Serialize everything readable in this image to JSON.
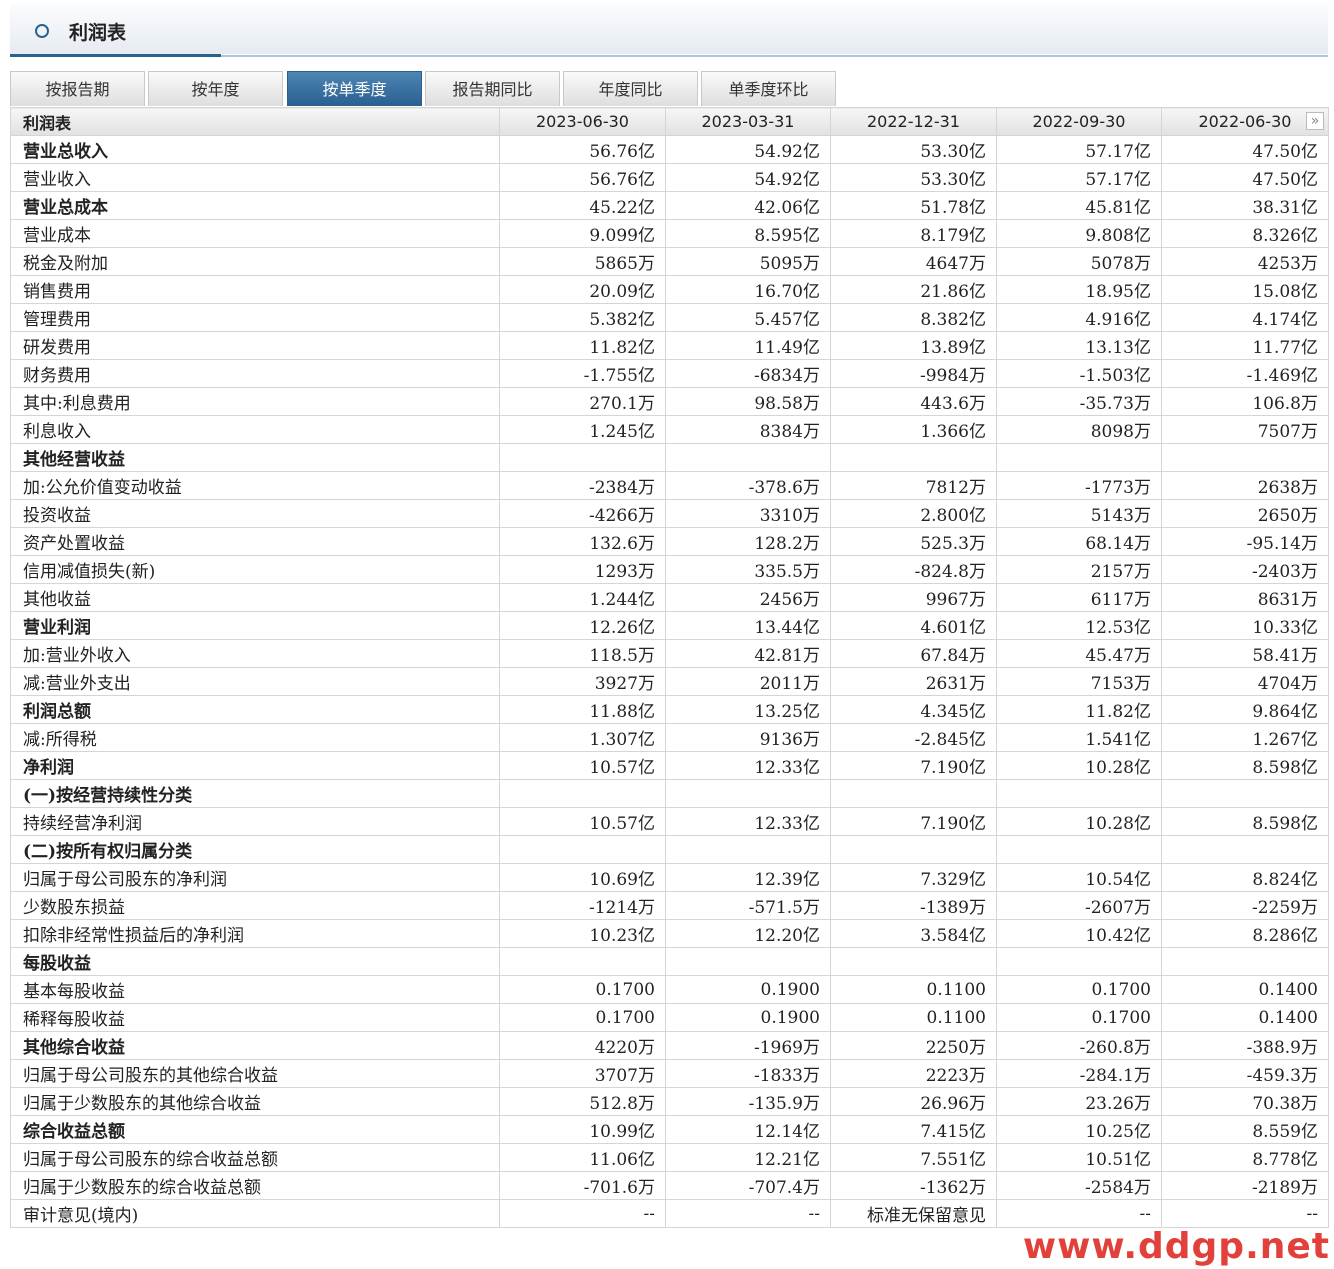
{
  "header": {
    "title": "利润表"
  },
  "tabs": [
    {
      "label": "按报告期",
      "active": false
    },
    {
      "label": "按年度",
      "active": false
    },
    {
      "label": "按单季度",
      "active": true
    },
    {
      "label": "报告期同比",
      "active": false
    },
    {
      "label": "年度同比",
      "active": false
    },
    {
      "label": "单季度环比",
      "active": false
    }
  ],
  "table": {
    "corner_label": "利润表",
    "periods": [
      "2023-06-30",
      "2023-03-31",
      "2022-12-31",
      "2022-09-30",
      "2022-06-30"
    ],
    "rows": [
      {
        "label": "营业总收入",
        "level": 0,
        "values": [
          "56.76亿",
          "54.92亿",
          "53.30亿",
          "57.17亿",
          "47.50亿"
        ]
      },
      {
        "label": "营业收入",
        "level": 1,
        "values": [
          "56.76亿",
          "54.92亿",
          "53.30亿",
          "57.17亿",
          "47.50亿"
        ]
      },
      {
        "label": "营业总成本",
        "level": 0,
        "values": [
          "45.22亿",
          "42.06亿",
          "51.78亿",
          "45.81亿",
          "38.31亿"
        ]
      },
      {
        "label": "营业成本",
        "level": 1,
        "values": [
          "9.099亿",
          "8.595亿",
          "8.179亿",
          "9.808亿",
          "8.326亿"
        ]
      },
      {
        "label": "税金及附加",
        "level": 1,
        "values": [
          "5865万",
          "5095万",
          "4647万",
          "5078万",
          "4253万"
        ]
      },
      {
        "label": "销售费用",
        "level": 1,
        "values": [
          "20.09亿",
          "16.70亿",
          "21.86亿",
          "18.95亿",
          "15.08亿"
        ]
      },
      {
        "label": "管理费用",
        "level": 1,
        "values": [
          "5.382亿",
          "5.457亿",
          "8.382亿",
          "4.916亿",
          "4.174亿"
        ]
      },
      {
        "label": "研发费用",
        "level": 1,
        "values": [
          "11.82亿",
          "11.49亿",
          "13.89亿",
          "13.13亿",
          "11.77亿"
        ]
      },
      {
        "label": "财务费用",
        "level": 1,
        "values": [
          "-1.755亿",
          "-6834万",
          "-9984万",
          "-1.503亿",
          "-1.469亿"
        ]
      },
      {
        "label": "其中:利息费用",
        "level": 1,
        "values": [
          "270.1万",
          "98.58万",
          "443.6万",
          "-35.73万",
          "106.8万"
        ]
      },
      {
        "label": "利息收入",
        "level": 3,
        "values": [
          "1.245亿",
          "8384万",
          "1.366亿",
          "8098万",
          "7507万"
        ]
      },
      {
        "label": "其他经营收益",
        "level": 0,
        "values": [
          "",
          "",
          "",
          "",
          ""
        ]
      },
      {
        "label": "加:公允价值变动收益",
        "level": 1,
        "values": [
          "-2384万",
          "-378.6万",
          "7812万",
          "-1773万",
          "2638万"
        ]
      },
      {
        "label": "投资收益",
        "level": 2,
        "values": [
          "-4266万",
          "3310万",
          "2.800亿",
          "5143万",
          "2650万"
        ]
      },
      {
        "label": "资产处置收益",
        "level": 1,
        "values": [
          "132.6万",
          "128.2万",
          "525.3万",
          "68.14万",
          "-95.14万"
        ]
      },
      {
        "label": "信用减值损失(新)",
        "level": 1,
        "values": [
          "1293万",
          "335.5万",
          "-824.8万",
          "2157万",
          "-2403万"
        ]
      },
      {
        "label": "其他收益",
        "level": 1,
        "values": [
          "1.244亿",
          "2456万",
          "9967万",
          "6117万",
          "8631万"
        ]
      },
      {
        "label": "营业利润",
        "level": 0,
        "values": [
          "12.26亿",
          "13.44亿",
          "4.601亿",
          "12.53亿",
          "10.33亿"
        ]
      },
      {
        "label": "加:营业外收入",
        "level": 1,
        "values": [
          "118.5万",
          "42.81万",
          "67.84万",
          "45.47万",
          "58.41万"
        ]
      },
      {
        "label": "减:营业外支出",
        "level": 1,
        "values": [
          "3927万",
          "2011万",
          "2631万",
          "7153万",
          "4704万"
        ]
      },
      {
        "label": "利润总额",
        "level": 0,
        "values": [
          "11.88亿",
          "13.25亿",
          "4.345亿",
          "11.82亿",
          "9.864亿"
        ]
      },
      {
        "label": "减:所得税",
        "level": 1,
        "values": [
          "1.307亿",
          "9136万",
          "-2.845亿",
          "1.541亿",
          "1.267亿"
        ]
      },
      {
        "label": "净利润",
        "level": 0,
        "values": [
          "10.57亿",
          "12.33亿",
          "7.190亿",
          "10.28亿",
          "8.598亿"
        ]
      },
      {
        "label": "(一)按经营持续性分类",
        "level": 0,
        "values": [
          "",
          "",
          "",
          "",
          ""
        ]
      },
      {
        "label": "持续经营净利润",
        "level": 1,
        "values": [
          "10.57亿",
          "12.33亿",
          "7.190亿",
          "10.28亿",
          "8.598亿"
        ]
      },
      {
        "label": "(二)按所有权归属分类",
        "level": 0,
        "values": [
          "",
          "",
          "",
          "",
          ""
        ]
      },
      {
        "label": "归属于母公司股东的净利润",
        "level": 1,
        "values": [
          "10.69亿",
          "12.39亿",
          "7.329亿",
          "10.54亿",
          "8.824亿"
        ]
      },
      {
        "label": "少数股东损益",
        "level": 1,
        "values": [
          "-1214万",
          "-571.5万",
          "-1389万",
          "-2607万",
          "-2259万"
        ]
      },
      {
        "label": "扣除非经常性损益后的净利润",
        "level": 1,
        "values": [
          "10.23亿",
          "12.20亿",
          "3.584亿",
          "10.42亿",
          "8.286亿"
        ]
      },
      {
        "label": "每股收益",
        "level": 0,
        "values": [
          "",
          "",
          "",
          "",
          ""
        ]
      },
      {
        "label": "基本每股收益",
        "level": 1,
        "values": [
          "0.1700",
          "0.1900",
          "0.1100",
          "0.1700",
          "0.1400"
        ]
      },
      {
        "label": "稀释每股收益",
        "level": 1,
        "values": [
          "0.1700",
          "0.1900",
          "0.1100",
          "0.1700",
          "0.1400"
        ]
      },
      {
        "label": "其他综合收益",
        "level": 0,
        "values": [
          "4220万",
          "-1969万",
          "2250万",
          "-260.8万",
          "-388.9万"
        ]
      },
      {
        "label": "归属于母公司股东的其他综合收益",
        "level": 1,
        "values": [
          "3707万",
          "-1833万",
          "2223万",
          "-284.1万",
          "-459.3万"
        ]
      },
      {
        "label": "归属于少数股东的其他综合收益",
        "level": 1,
        "values": [
          "512.8万",
          "-135.9万",
          "26.96万",
          "23.26万",
          "70.38万"
        ]
      },
      {
        "label": "综合收益总额",
        "level": 0,
        "values": [
          "10.99亿",
          "12.14亿",
          "7.415亿",
          "10.25亿",
          "8.559亿"
        ]
      },
      {
        "label": "归属于母公司股东的综合收益总额",
        "level": 1,
        "values": [
          "11.06亿",
          "12.21亿",
          "7.551亿",
          "10.51亿",
          "8.778亿"
        ]
      },
      {
        "label": "归属于少数股东的综合收益总额",
        "level": 1,
        "values": [
          "-701.6万",
          "-707.4万",
          "-1362万",
          "-2584万",
          "-2189万"
        ]
      },
      {
        "label": "审计意见(境内)",
        "level": 1,
        "values": [
          "--",
          "--",
          "标准无保留意见",
          "--",
          "--"
        ]
      }
    ]
  },
  "next_button": {
    "glyph": "»"
  },
  "watermark": "www.ddgp.net",
  "colors": {
    "accent": "#28628f",
    "watermark": "#e0302a"
  }
}
